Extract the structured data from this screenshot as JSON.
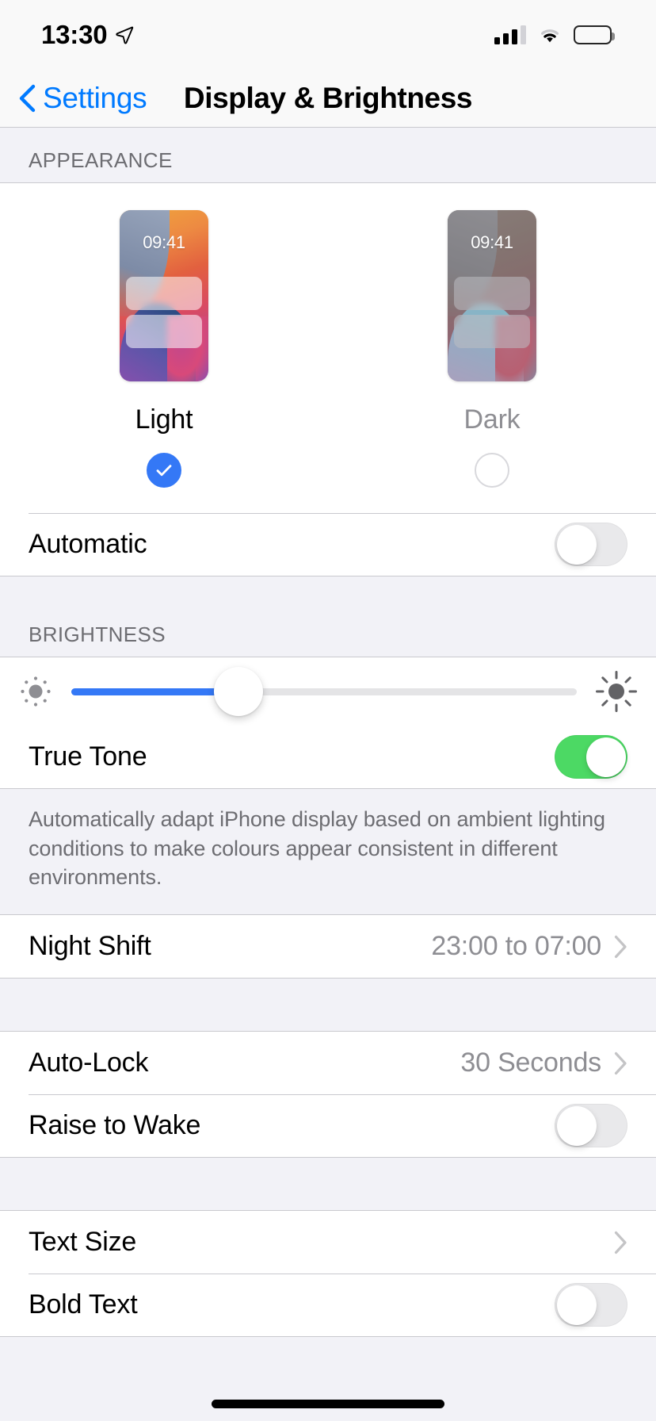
{
  "status_bar": {
    "time": "13:30",
    "location_icon": "location-arrow-icon",
    "signal_icon": "cellular-signal-icon",
    "wifi_icon": "wifi-icon",
    "battery_icon": "battery-full-icon"
  },
  "nav": {
    "back_label": "Settings",
    "back_icon": "chevron-left-icon",
    "title": "Display & Brightness"
  },
  "appearance": {
    "header": "APPEARANCE",
    "options": [
      {
        "name": "Light",
        "preview_time": "09:41",
        "selected": true
      },
      {
        "name": "Dark",
        "preview_time": "09:41",
        "selected": false
      }
    ],
    "automatic": {
      "label": "Automatic",
      "value": "off"
    }
  },
  "brightness": {
    "header": "BRIGHTNESS",
    "slider": {
      "value_percent": 33,
      "low_icon": "sun-low-icon",
      "high_icon": "sun-high-icon"
    },
    "true_tone": {
      "label": "True Tone",
      "value": "on"
    },
    "footer": "Automatically adapt iPhone display based on ambient lighting conditions to make colours appear consistent in different environments.",
    "night_shift": {
      "label": "Night Shift",
      "value": "23:00 to 07:00",
      "chevron": "chevron-right-icon"
    }
  },
  "lock": {
    "auto_lock": {
      "label": "Auto-Lock",
      "value": "30 Seconds",
      "chevron": "chevron-right-icon"
    },
    "raise_to_wake": {
      "label": "Raise to Wake",
      "value": "off"
    }
  },
  "text": {
    "text_size": {
      "label": "Text Size",
      "chevron": "chevron-right-icon"
    },
    "bold_text": {
      "label": "Bold Text",
      "value": "off"
    }
  },
  "colors": {
    "accent_blue": "#007aff",
    "slider_blue": "#3478f6",
    "toggle_on_green": "#4cd964",
    "group_bg": "#ffffff",
    "page_bg": "#f2f2f7",
    "secondary_text": "#8e8e93"
  }
}
